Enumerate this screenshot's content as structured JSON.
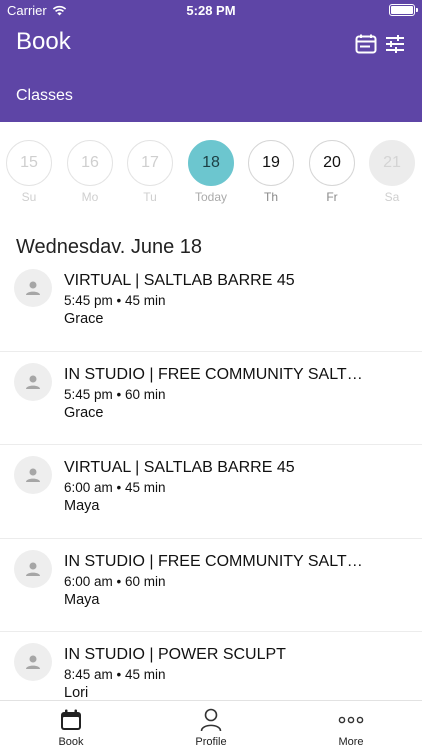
{
  "status_bar": {
    "carrier": "Carrier",
    "time": "5:28 PM"
  },
  "header": {
    "title": "Book",
    "subtitle": "Classes"
  },
  "week": [
    {
      "num": "15",
      "day": "Su",
      "state": "past"
    },
    {
      "num": "16",
      "day": "Mo",
      "state": "past"
    },
    {
      "num": "17",
      "day": "Tu",
      "state": "past"
    },
    {
      "num": "18",
      "day": "Today",
      "state": "selected"
    },
    {
      "num": "19",
      "day": "Th",
      "state": "active"
    },
    {
      "num": "20",
      "day": "Fr",
      "state": "active"
    },
    {
      "num": "21",
      "day": "Sa",
      "state": "grey"
    }
  ],
  "date_heading": "Wednesdav. June 18",
  "classes": [
    {
      "name": "VIRTUAL | SALTLAB BARRE 45",
      "meta": "5:45 pm • 45 min",
      "instructor": "Grace"
    },
    {
      "name": "IN STUDIO | FREE COMMUNITY SALT…",
      "meta": "5:45 pm • 60 min",
      "instructor": "Grace"
    },
    {
      "name": "VIRTUAL | SALTLAB BARRE 45",
      "meta": "6:00 am • 45 min",
      "instructor": "Maya"
    },
    {
      "name": "IN STUDIO | FREE COMMUNITY SALT…",
      "meta": "6:00 am • 60 min",
      "instructor": "Maya"
    },
    {
      "name": "IN STUDIO | POWER SCULPT",
      "meta": "8:45 am • 45 min",
      "instructor": "Lori"
    }
  ],
  "tabs": [
    {
      "label": "Book",
      "icon": "calendar-icon"
    },
    {
      "label": "Profile",
      "icon": "person-icon"
    },
    {
      "label": "More",
      "icon": "more-icon"
    }
  ],
  "colors": {
    "header": "#5e45a6",
    "selected_day": "#6cc6cf"
  }
}
